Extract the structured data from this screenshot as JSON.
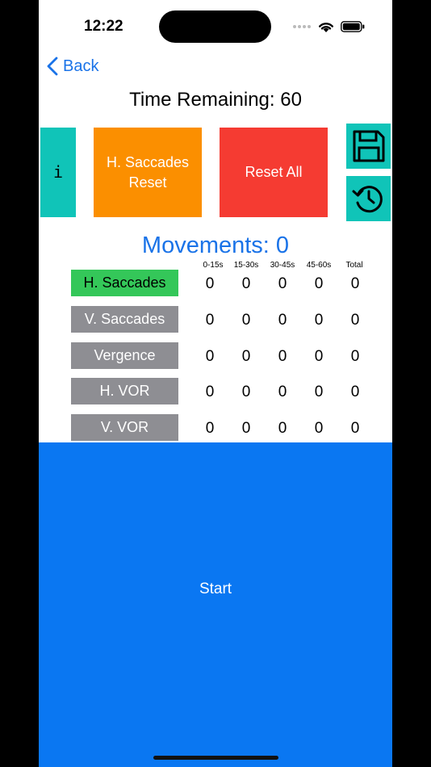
{
  "status": {
    "time": "12:22"
  },
  "nav": {
    "back_label": "Back"
  },
  "timer": {
    "text": "Time Remaining: 60"
  },
  "buttons": {
    "info_label": "i",
    "h_saccades_reset": "H. Saccades Reset",
    "reset_all": "Reset All",
    "save_icon": "floppy-disk-icon",
    "history_icon": "history-icon"
  },
  "movements": {
    "text": "Movements: 0"
  },
  "columns": [
    "0-15s",
    "15-30s",
    "30-45s",
    "45-60s",
    "Total"
  ],
  "exercises": [
    {
      "label": "H. Saccades",
      "color": "#34c759",
      "text_color": "#000000",
      "values": [
        "0",
        "0",
        "0",
        "0",
        "0"
      ]
    },
    {
      "label": "V. Saccades",
      "color": "#8e8e93",
      "text_color": "#ffffff",
      "values": [
        "0",
        "0",
        "0",
        "0",
        "0"
      ]
    },
    {
      "label": "Vergence",
      "color": "#8e8e93",
      "text_color": "#ffffff",
      "values": [
        "0",
        "0",
        "0",
        "0",
        "0"
      ]
    },
    {
      "label": "H. VOR",
      "color": "#8e8e93",
      "text_color": "#ffffff",
      "values": [
        "0",
        "0",
        "0",
        "0",
        "0"
      ]
    },
    {
      "label": "V. VOR",
      "color": "#8e8e93",
      "text_color": "#ffffff",
      "values": [
        "0",
        "0",
        "0",
        "0",
        "0"
      ]
    }
  ],
  "start": {
    "label": "Start"
  },
  "colors": {
    "teal": "#10c4b8",
    "orange": "#fb8f00",
    "red": "#f53b32",
    "blue": "#0a77f2",
    "link": "#1a73e8"
  }
}
